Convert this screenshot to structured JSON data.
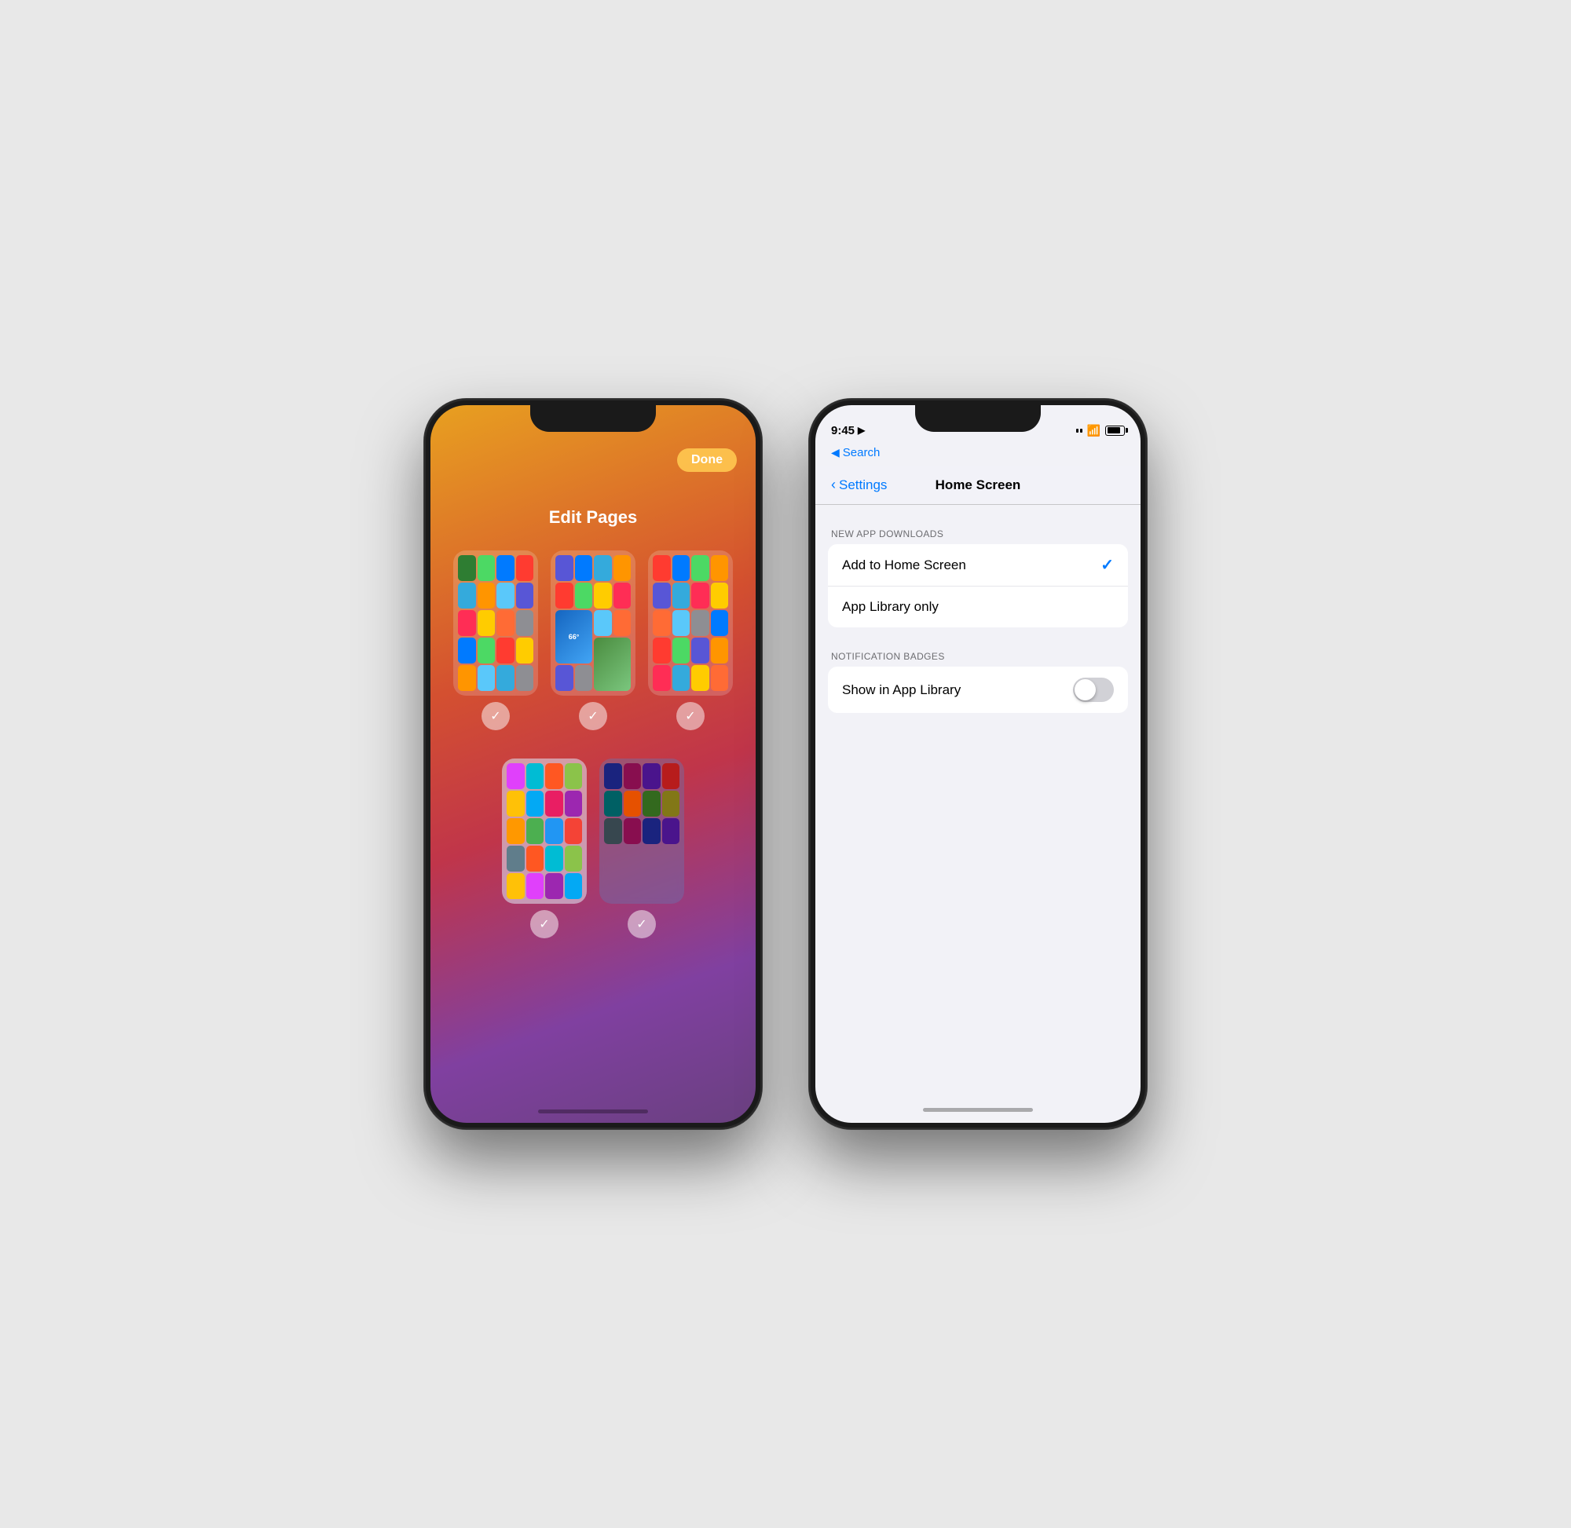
{
  "phone1": {
    "done_label": "Done",
    "title": "Edit Pages",
    "pages_count": 5
  },
  "phone2": {
    "status": {
      "time": "9:45",
      "location_arrow": "▶",
      "search_back": "◀ Search"
    },
    "nav": {
      "back_label": "Settings",
      "title": "Home Screen"
    },
    "sections": {
      "new_app_downloads": {
        "header": "NEW APP DOWNLOADS",
        "options": [
          {
            "label": "Add to Home Screen",
            "selected": true
          },
          {
            "label": "App Library only",
            "selected": false
          }
        ]
      },
      "notification_badges": {
        "header": "NOTIFICATION BADGES",
        "options": [
          {
            "label": "Show in App Library",
            "toggle": false
          }
        ]
      }
    }
  }
}
